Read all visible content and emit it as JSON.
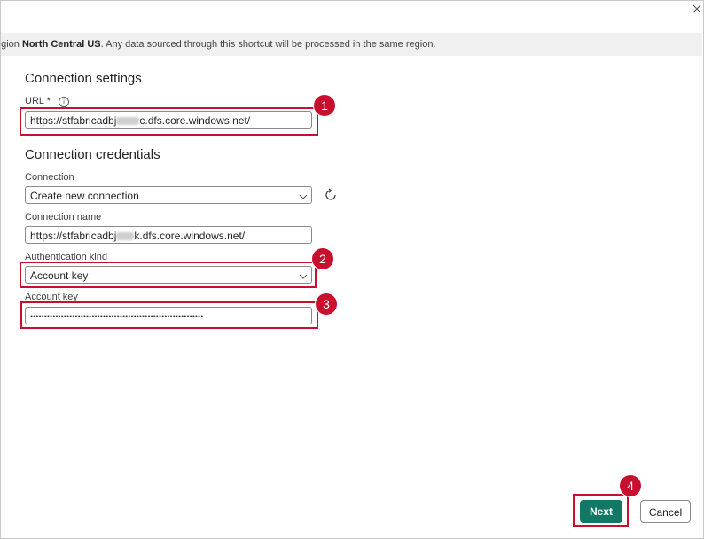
{
  "banner": {
    "prefix": "egion ",
    "region": "North Central US",
    "suffix": ". Any data sourced through this shortcut will be processed in the same region."
  },
  "connection_settings": {
    "title": "Connection settings",
    "url_label": "URL",
    "required_mark": "*",
    "url_value_start": "https://stfabricadbj",
    "url_value_end": "c.dfs.core.windows.net/"
  },
  "connection_credentials": {
    "title": "Connection credentials",
    "connection_label": "Connection",
    "connection_value": "Create new connection",
    "connection_name_label": "Connection name",
    "connection_name_start": "https://stfabricadbj",
    "connection_name_end": "k.dfs.core.windows.net/",
    "auth_kind_label": "Authentication kind",
    "auth_kind_value": "Account key",
    "account_key_label": "Account key",
    "account_key_value": "••••••••••••••••••••••••••••••••••••••••••••••••••••••••••••••"
  },
  "annotations": [
    "1",
    "2",
    "3",
    "4"
  ],
  "footer": {
    "next_label": "Next",
    "cancel_label": "Cancel"
  },
  "colors": {
    "primary": "#117865",
    "highlight": "#c8102e",
    "banner_bg": "#f0f0f0"
  },
  "icons": [
    "close-icon",
    "info-icon",
    "chevron-down-icon",
    "refresh-icon"
  ]
}
